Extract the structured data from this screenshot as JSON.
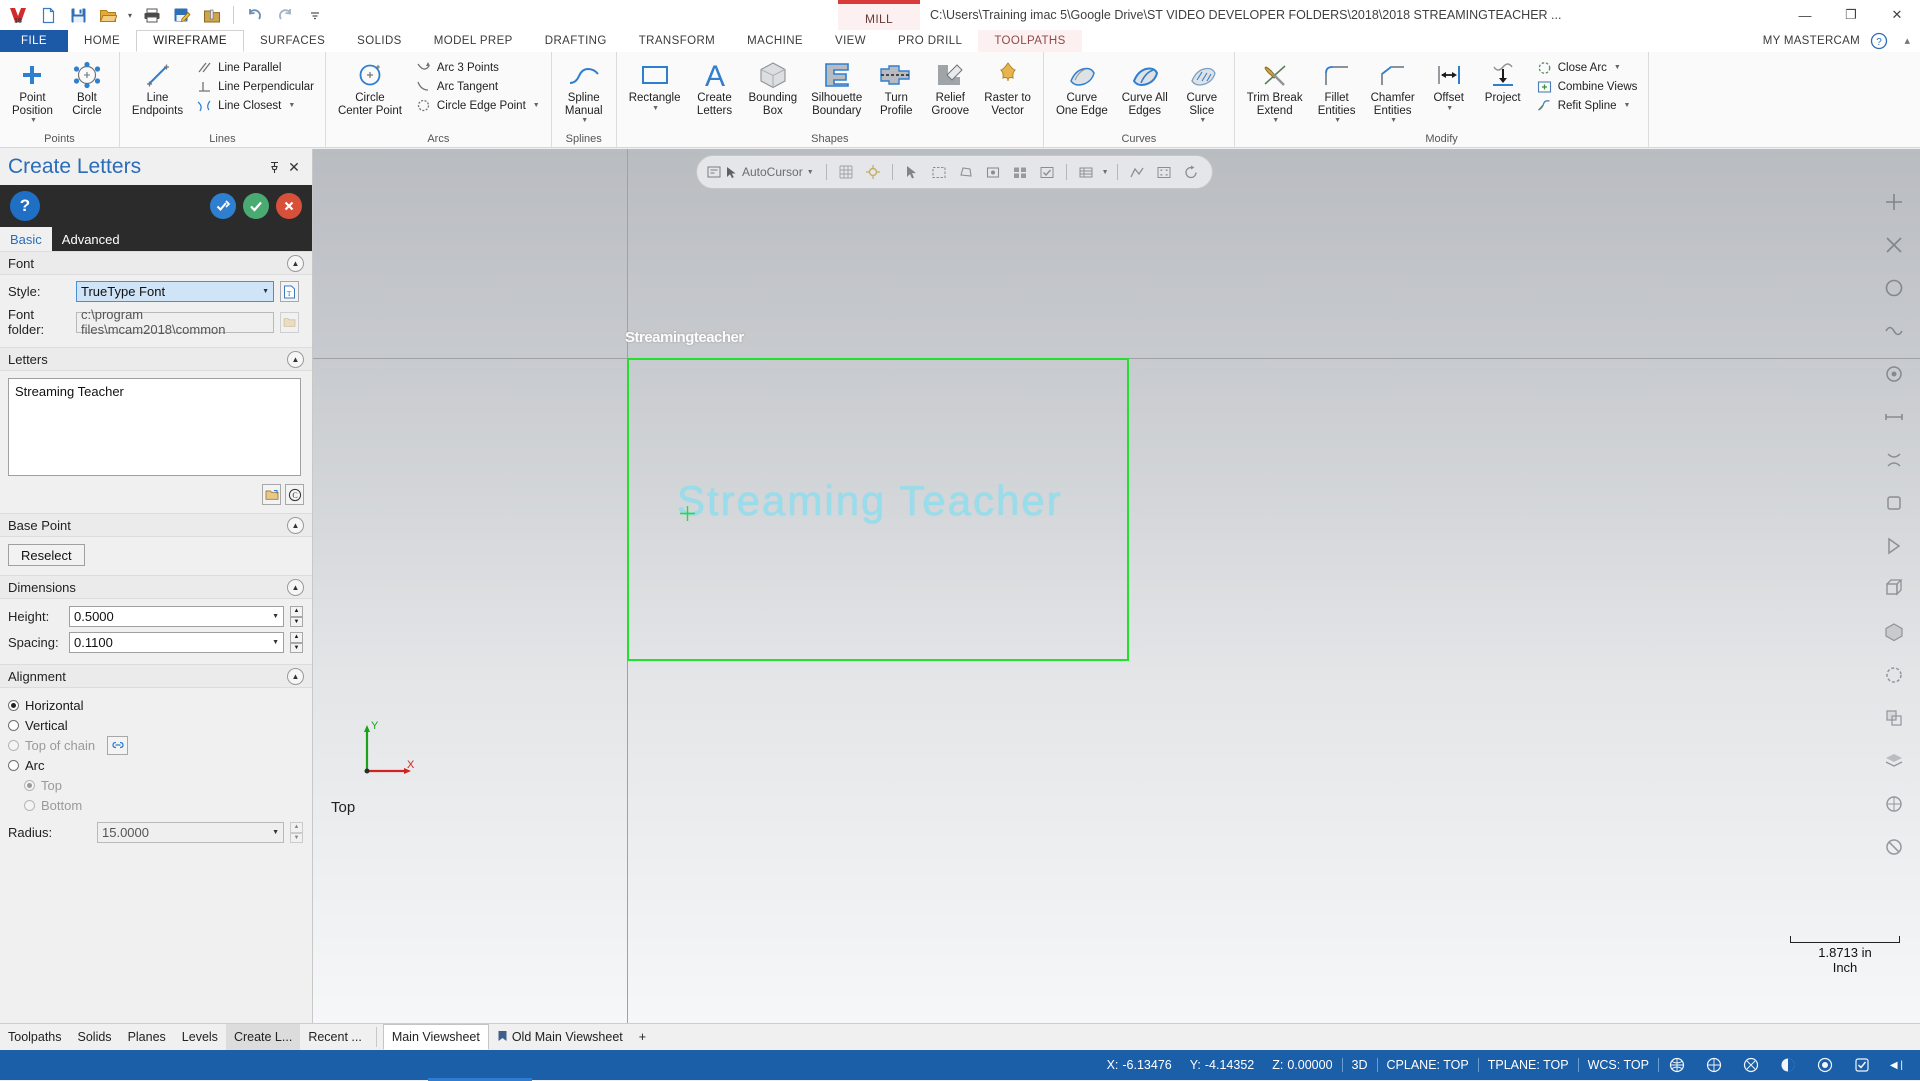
{
  "titlebar": {
    "quick_access": [
      {
        "name": "mastercam-logo-icon",
        "label": "Mastercam 2018"
      },
      {
        "name": "new-file-icon",
        "label": "New"
      },
      {
        "name": "save-icon",
        "label": "Save"
      },
      {
        "name": "open-folder-icon",
        "label": "Open"
      },
      {
        "name": "print-icon",
        "label": "Print"
      },
      {
        "name": "save-as-icon",
        "label": "Save As"
      },
      {
        "name": "zip2go-icon",
        "label": "Zip2Go"
      },
      {
        "name": "undo-icon",
        "label": "Undo"
      },
      {
        "name": "redo-icon",
        "label": "Redo"
      },
      {
        "name": "customize-qat-icon",
        "label": "Customize Quick Access Toolbar"
      }
    ],
    "machine_group": "MILL",
    "document_path": "C:\\Users\\Training imac 5\\Google Drive\\ST VIDEO DEVELOPER FOLDERS\\2018\\2018 STREAMINGTEACHER ...",
    "minimize": "—",
    "restore": "❐",
    "close": "✕"
  },
  "ribbon": {
    "tabs": [
      {
        "label": "FILE",
        "state": "file"
      },
      {
        "label": "HOME",
        "state": "normal"
      },
      {
        "label": "WIREFRAME",
        "state": "active"
      },
      {
        "label": "SURFACES",
        "state": "normal"
      },
      {
        "label": "SOLIDS",
        "state": "normal"
      },
      {
        "label": "MODEL PREP",
        "state": "normal"
      },
      {
        "label": "DRAFTING",
        "state": "normal"
      },
      {
        "label": "TRANSFORM",
        "state": "normal"
      },
      {
        "label": "MACHINE",
        "state": "normal"
      },
      {
        "label": "VIEW",
        "state": "normal"
      },
      {
        "label": "PRO DRILL",
        "state": "normal"
      },
      {
        "label": "TOOLPATHS",
        "state": "toolpaths"
      }
    ],
    "my_mastercam": "MY MASTERCAM",
    "groups": [
      {
        "label": "Points",
        "big": [
          {
            "label": "Point\nPosition",
            "icon": "point-position-icon",
            "dropdown": true
          },
          {
            "label": "Bolt\nCircle",
            "icon": "bolt-circle-icon",
            "dropdown": false
          }
        ],
        "small": []
      },
      {
        "label": "Lines",
        "big": [
          {
            "label": "Line\nEndpoints",
            "icon": "line-endpoints-icon",
            "dropdown": false
          }
        ],
        "small": [
          {
            "label": "Line Parallel",
            "icon": "line-parallel-icon",
            "dropdown": false
          },
          {
            "label": "Line Perpendicular",
            "icon": "line-perpendicular-icon",
            "dropdown": false
          },
          {
            "label": "Line Closest",
            "icon": "line-closest-icon",
            "dropdown": true
          }
        ]
      },
      {
        "label": "Arcs",
        "big": [
          {
            "label": "Circle\nCenter Point",
            "icon": "circle-center-point-icon",
            "dropdown": false
          }
        ],
        "small": [
          {
            "label": "Arc 3 Points",
            "icon": "arc-3-points-icon",
            "dropdown": false
          },
          {
            "label": "Arc Tangent",
            "icon": "arc-tangent-icon",
            "dropdown": false
          },
          {
            "label": "Circle Edge Point",
            "icon": "circle-edge-point-icon",
            "dropdown": true
          }
        ]
      },
      {
        "label": "Splines",
        "big": [
          {
            "label": "Spline\nManual",
            "icon": "spline-manual-icon",
            "dropdown": true
          }
        ],
        "small": []
      },
      {
        "label": "Shapes",
        "big": [
          {
            "label": "Rectangle",
            "icon": "rectangle-icon",
            "dropdown": true
          },
          {
            "label": "Create\nLetters",
            "icon": "create-letters-icon",
            "dropdown": false
          },
          {
            "label": "Bounding\nBox",
            "icon": "bounding-box-icon",
            "dropdown": false
          },
          {
            "label": "Silhouette\nBoundary",
            "icon": "silhouette-boundary-icon",
            "dropdown": false
          },
          {
            "label": "Turn\nProfile",
            "icon": "turn-profile-icon",
            "dropdown": false
          },
          {
            "label": "Relief\nGroove",
            "icon": "relief-groove-icon",
            "dropdown": false
          },
          {
            "label": "Raster to\nVector",
            "icon": "raster-to-vector-icon",
            "dropdown": false
          }
        ],
        "small": []
      },
      {
        "label": "Curves",
        "big": [
          {
            "label": "Curve\nOne Edge",
            "icon": "curve-one-edge-icon",
            "dropdown": false
          },
          {
            "label": "Curve All\nEdges",
            "icon": "curve-all-edges-icon",
            "dropdown": false
          },
          {
            "label": "Curve\nSlice",
            "icon": "curve-slice-icon",
            "dropdown": true
          }
        ],
        "small": []
      },
      {
        "label": "Modify",
        "big": [
          {
            "label": "Trim Break\nExtend",
            "icon": "trim-break-extend-icon",
            "dropdown": true
          },
          {
            "label": "Fillet\nEntities",
            "icon": "fillet-entities-icon",
            "dropdown": true
          },
          {
            "label": "Chamfer\nEntities",
            "icon": "chamfer-entities-icon",
            "dropdown": true
          },
          {
            "label": "Offset",
            "icon": "offset-icon",
            "dropdown": true
          },
          {
            "label": "Project",
            "icon": "project-icon",
            "dropdown": false
          }
        ],
        "small": [
          {
            "label": "Close Arc",
            "icon": "close-arc-icon",
            "dropdown": true
          },
          {
            "label": "Combine Views",
            "icon": "combine-views-icon",
            "dropdown": false
          },
          {
            "label": "Refit Spline",
            "icon": "refit-spline-icon",
            "dropdown": true
          }
        ]
      }
    ]
  },
  "panel": {
    "title": "Create Letters",
    "pin_icon": "pin-icon",
    "close_icon": "close-icon",
    "toolbar": {
      "help": "?",
      "apply_reselect": "apply-and-create-new-operation-icon",
      "ok": "✔",
      "cancel": "✖"
    },
    "tabs": [
      {
        "label": "Basic",
        "active": true
      },
      {
        "label": "Advanced",
        "active": false
      }
    ],
    "font_section": {
      "header": "Font",
      "style_label": "Style:",
      "style_value": "TrueType Font",
      "style_browse_icon": "truetype-browse-icon",
      "folder_label": "Font folder:",
      "folder_value": "c:\\program files\\mcam2018\\common",
      "folder_browse_icon": "folder-browse-icon"
    },
    "letters_section": {
      "header": "Letters",
      "value": "Streaming Teacher",
      "placeholder": "",
      "open_file_icon": "open-text-file-icon",
      "copyright_icon": "special-character-icon"
    },
    "base_point_section": {
      "header": "Base Point",
      "reselect_label": "Reselect"
    },
    "dimensions_section": {
      "header": "Dimensions",
      "height_label": "Height:",
      "height_value": "0.5000",
      "spacing_label": "Spacing:",
      "spacing_value": "0.1100"
    },
    "alignment_section": {
      "header": "Alignment",
      "options": [
        {
          "label": "Horizontal",
          "selected": true,
          "disabled": false,
          "indent": 0
        },
        {
          "label": "Vertical",
          "selected": false,
          "disabled": false,
          "indent": 0
        },
        {
          "label": "Top of chain",
          "selected": false,
          "disabled": true,
          "indent": 0,
          "link_icon": "chain-link-icon"
        },
        {
          "label": "Arc",
          "selected": false,
          "disabled": false,
          "indent": 0
        },
        {
          "label": "Top",
          "selected": true,
          "disabled": true,
          "indent": 1
        },
        {
          "label": "Bottom",
          "selected": false,
          "disabled": true,
          "indent": 1
        }
      ],
      "radius_label": "Radius:",
      "radius_value": "15.0000"
    }
  },
  "viewport": {
    "autocursor_label": "AutoCursor",
    "quick_icons": [
      "select-entity-icon",
      "window-select-icon",
      "polygon-select-icon",
      "single-select-icon",
      "all-entities-icon",
      "only-entities-icon",
      "analyze-icon",
      "grid-snap-icon",
      "levels-icon",
      "wireframe-shading-icon",
      "fit-screen-icon",
      "repaint-icon"
    ],
    "ghost_text": "Streamingteacher",
    "cad_text": "Streaming Teacher",
    "view_label": "Top",
    "axis_x": "X",
    "axis_y": "Y",
    "scale_value": "1.8713 in",
    "scale_unit": "Inch",
    "green_color": "#22e02b",
    "text_color": "#8ddff0"
  },
  "vtoolbar_icons": [
    "fit-icon",
    "unzoom-icon",
    "zoom-window-icon",
    "dynamic-rotate-icon",
    "pan-icon",
    "isometric-view-icon",
    "top-view-icon",
    "front-view-icon",
    "right-view-icon",
    "wireframe-icon",
    "shaded-icon",
    "hidden-lines-icon",
    "translucency-icon",
    "levels-visibility-icon",
    "wcs-icon",
    "blank-icon"
  ],
  "bottom_tabs": {
    "panel_tabs": [
      {
        "label": "Toolpaths",
        "selected": false
      },
      {
        "label": "Solids",
        "selected": false
      },
      {
        "label": "Planes",
        "selected": false
      },
      {
        "label": "Levels",
        "selected": false
      },
      {
        "label": "Create L...",
        "selected": true
      },
      {
        "label": "Recent ...",
        "selected": false
      }
    ],
    "viewsheets": [
      {
        "label": "Main Viewsheet",
        "selected": true,
        "icon": null
      },
      {
        "label": "Old Main Viewsheet",
        "selected": false,
        "icon": "viewsheet-icon"
      }
    ],
    "add_viewsheet": "+"
  },
  "statusbar": {
    "coords": [
      {
        "label": "X:",
        "value": "-6.13476"
      },
      {
        "label": "Y:",
        "value": "-4.14352"
      },
      {
        "label": "Z:",
        "value": "0.00000"
      }
    ],
    "mode": "3D",
    "cplane": "CPLANE: TOP",
    "tplane": "TPLANE: TOP",
    "wcs": "WCS: TOP",
    "right_icons": [
      "globe-cplane-icon",
      "globe-tplane-icon",
      "globe-wcs-icon",
      "shading-toggle-icon",
      "wireframe-toggle-icon",
      "selection-icon"
    ],
    "arrow": "◀ |"
  }
}
